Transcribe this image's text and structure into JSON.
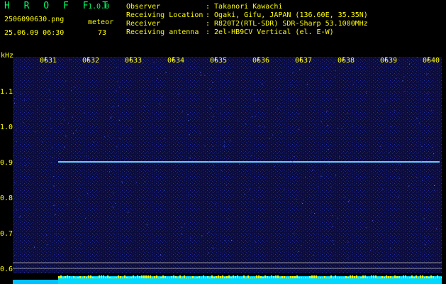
{
  "header": {
    "app_title": "H R O F F T",
    "app_version": "1.0.0",
    "file_name": "2506090630.png",
    "datetime": "25.06.09 06:30",
    "meteor_label": "meteor",
    "meteor_count": "73",
    "info": [
      {
        "key": "Observer",
        "value": ": Takanori Kawachi"
      },
      {
        "key": "Receiving Location",
        "value": ": Ogaki, Gifu, JAPAN (136.60E, 35.35N)"
      },
      {
        "key": "Receiver",
        "value": ": R820T2(RTL-SDR) SDR-Sharp 53.1000MHz"
      },
      {
        "key": "Receiving antenna",
        "value": ": 2el-HB9CV Vertical (el. E-W)"
      }
    ]
  },
  "axis": {
    "y_unit": "kHz",
    "y_labels": [
      "1.1",
      "1.0",
      "0.9",
      "0.8",
      "0.7",
      "0.6"
    ],
    "x_labels": [
      "0631",
      "0632",
      "0633",
      "0634",
      "0635",
      "0636",
      "0637",
      "0638",
      "0639",
      "0640"
    ]
  },
  "colors": {
    "background": "#0a0a3a",
    "carrier": "#66ccff",
    "text": "#ffff00"
  }
}
